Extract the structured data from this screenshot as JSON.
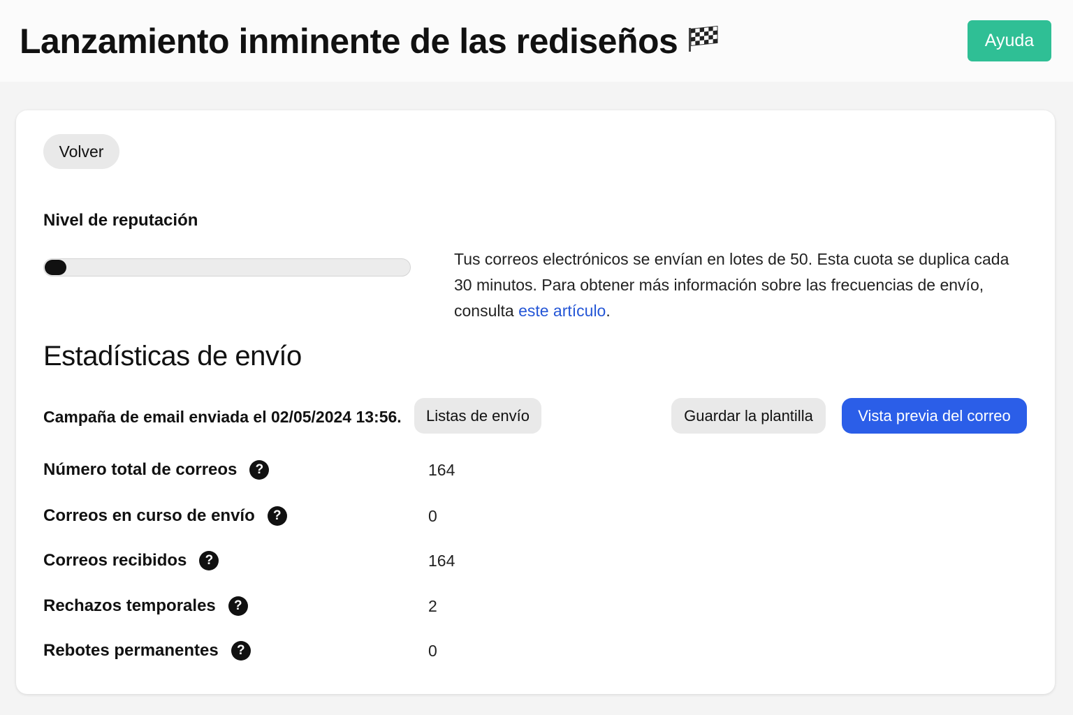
{
  "header": {
    "title": "Lanzamiento inminente de las rediseños",
    "flag_icon": "checkered-flag-icon",
    "help_label": "Ayuda",
    "help_color": "#2fbf95"
  },
  "card": {
    "back_label": "Volver",
    "reputation": {
      "label": "Nivel de reputación",
      "level_fraction": 0.06
    },
    "info": {
      "text_before": "Tus correos electrónicos se envían en lotes de 50. Esta cuota se duplica cada 30 minutos. Para obtener más información sobre las frecuencias de envío, consulta ",
      "link_text": "este artículo",
      "text_after": ".",
      "link_color": "#2456d6"
    },
    "stats_heading": "Estadísticas de envío",
    "campaign_text": "Campaña de email enviada el 02/05/2024 13:56.",
    "buttons": {
      "lists_label": "Listas de envío",
      "save_template_label": "Guardar la plantilla",
      "preview_label": "Vista previa del correo",
      "preview_color": "#2b5ee8"
    },
    "stats": [
      {
        "label": "Número total de correos",
        "value": "164",
        "icon": "question-circle-icon"
      },
      {
        "label": "Correos en curso de envío",
        "value": "0",
        "icon": "question-circle-icon"
      },
      {
        "label": "Correos recibidos",
        "value": "164",
        "icon": "question-circle-icon"
      },
      {
        "label": "Rechazos temporales",
        "value": "2",
        "icon": "question-circle-icon"
      },
      {
        "label": "Rebotes permanentes",
        "value": "0",
        "icon": "question-circle-icon"
      }
    ],
    "help_icon_glyph": "?"
  }
}
